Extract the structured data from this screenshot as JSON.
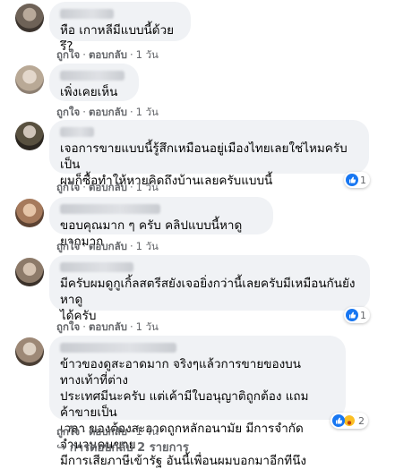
{
  "comments": [
    {
      "text": "หือ เกาหลีมีแบบนี้ด้วยรึ?",
      "like_label": "ถูกใจ",
      "reply_label": "ตอบกลับ",
      "time": "1 วัน",
      "reaction_count": ""
    },
    {
      "text": "เพิ่งเคยเห็น",
      "like_label": "ถูกใจ",
      "reply_label": "ตอบกลับ",
      "time": "1 วัน",
      "reaction_count": ""
    },
    {
      "text": "เจอการขายแบบนี้รู้สึกเหมือนอยู่เมืองไทยเลยใช่ไหมครับ เป็น\nผมก็ซื้อทำให้หายคิดถึงบ้านเลยครับแบบนี้",
      "like_label": "ถูกใจ",
      "reply_label": "ตอบกลับ",
      "time": "1 วัน",
      "reaction_count": "1"
    },
    {
      "text": "ขอบคุณมาก ๆ ครับ คลิปแบบนี้หาดูยากมาก",
      "like_label": "ถูกใจ",
      "reply_label": "ตอบกลับ",
      "time": "1 วัน",
      "reaction_count": ""
    },
    {
      "text": "มีครับผมดูกูเกิ้ลสตรีสยังเจอยิ่งกว่านี้เลยครับมีเหมือนกันยังหาดู\nได้ครับ",
      "like_label": "ถูกใจ",
      "reply_label": "ตอบกลับ",
      "time": "1 วัน",
      "reaction_count": "1"
    },
    {
      "text": "ข้าวของดูสะอาดมาก จริงๆแล้วการขายของบนทางเท้าที่ต่าง\nประเทศมีนะครับ แต่เค้ามีใบอนุญาติถูกต้อง แถมค้าขายเป็น\nเวลา ของต้องสะอาดถูกหลักอนามัย มีการจำกัดจำนวนคนขาย\nมีการเสียภาษีเข้ารัฐ อันนี้เพื่อนผมบอกมาอีกทีนึง",
      "like_label": "ถูกใจ",
      "reply_label": "ตอบกลับ",
      "time": "1 วัน",
      "reaction_count": "2"
    }
  ],
  "replies_label": "การตอบกลับ 2 รายการ",
  "colors": {
    "bubble": "#f0f2f5",
    "meta": "#65676b",
    "like_blue": "#1877f2"
  }
}
